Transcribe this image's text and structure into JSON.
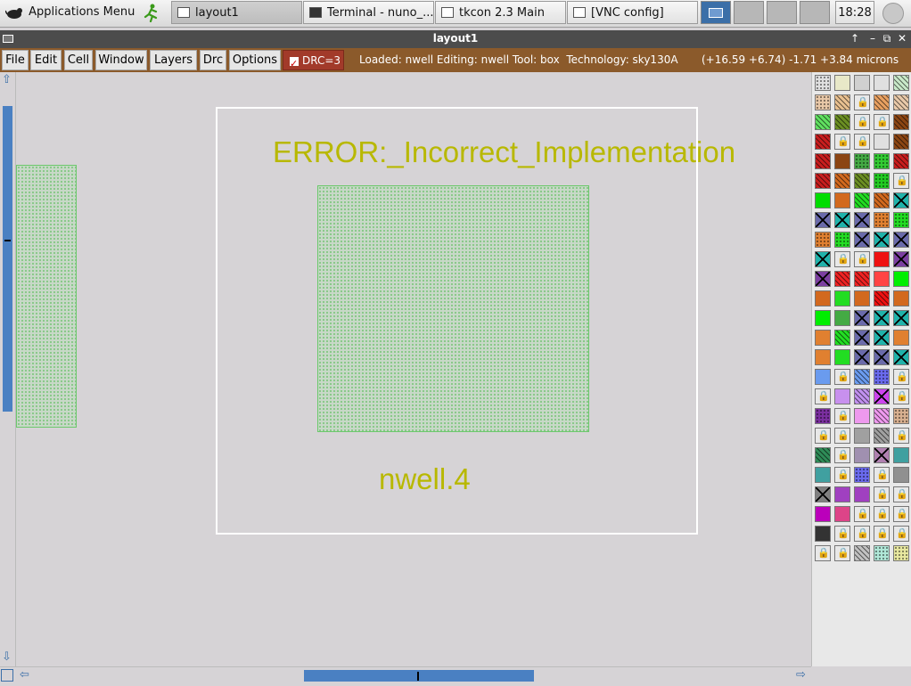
{
  "taskbar": {
    "apps_menu_label": "Applications Menu",
    "tasks": [
      {
        "label": "layout1",
        "active": true
      },
      {
        "label": "Terminal - nuno_...",
        "active": false
      },
      {
        "label": "tkcon 2.3 Main",
        "active": false
      },
      {
        "label": "[VNC config]",
        "active": false
      }
    ],
    "clock": "18:28"
  },
  "window": {
    "title": "layout1"
  },
  "menubar": {
    "items": [
      "File",
      "Edit",
      "Cell",
      "Window",
      "Layers",
      "Drc",
      "Options"
    ],
    "drc_label": "DRC=3",
    "status": "Loaded: nwell Editing: nwell Tool: box  Technology: sky130A",
    "coords": "(+16.59 +6.74) -1.71 +3.84 microns"
  },
  "canvas": {
    "error_label": "ERROR:_Incorrect_Implementation",
    "rule_label": "nwell.4",
    "colors": {
      "label_text": "#b8b800",
      "nwell_border": "#6cc86c",
      "selection_box": "#ffffff"
    }
  },
  "palette": {
    "rows": [
      [
        "#e0e0e0:dots",
        "#e8e8c8",
        "#d0d0d0",
        "#e0e0e0",
        "#c8e8c8:hatch"
      ],
      [
        "#e8c8a8:dots",
        "#e8c090:hatch",
        "#e8e8e8:lock",
        "#e8a060:hatch",
        "#e8c8a8:hatch"
      ],
      [
        "#60e060:hatch",
        "#6b8e23:hatch",
        "#e8e8e8:lock",
        "#e8e8e8:lock",
        "#8b4513:hatch"
      ],
      [
        "#c81e1e:hatch",
        "#e8e8e8:lock",
        "#e8e8e8:lock",
        "#e0e0e0",
        "#8b4513:hatch"
      ],
      [
        "#c81e1e:hatch",
        "#8b4513",
        "#44aa44:dots",
        "#33cc33:dots",
        "#c81e1e:hatch"
      ],
      [
        "#c81e1e:hatch",
        "#d2691e:hatch",
        "#6b8e23:hatch",
        "#22cc22:dots",
        "#e8e8e8:lock"
      ],
      [
        "#00dd00",
        "#d2691e",
        "#22dd22:hatch",
        "#d2691e:hatch",
        "#20b2aa:xx"
      ],
      [
        "#6a6aaa:xx",
        "#20b2aa:xx",
        "#6a6aaa:xx",
        "#e08030:dots",
        "#22dd22:dots"
      ],
      [
        "#e08030:dots",
        "#22dd22:dots",
        "#6a6aaa:xx",
        "#20b2aa:xx",
        "#6a6aaa:xx"
      ],
      [
        "#20b2aa:xx",
        "#e8e8e8:lock",
        "#e8e8e8:lock",
        "#ee1111",
        "#7b3fa0:xx"
      ],
      [
        "#7b3fa0:xx",
        "#ee2222:hatch",
        "#ee2222:hatch",
        "#ff4444",
        "#00ee00"
      ],
      [
        "#d2691e",
        "#22dd22",
        "#d2691e",
        "#ee1111:hatch",
        "#d2691e"
      ],
      [
        "#00ee00",
        "#44aa44",
        "#6a6aaa:xx",
        "#20b2aa:xx",
        "#20b2aa:xx"
      ],
      [
        "#e08030",
        "#22dd22:hatch",
        "#6a6aaa:xx",
        "#20b2aa:xx",
        "#e08030"
      ],
      [
        "#e08030",
        "#22dd22",
        "#6a6aaa:xx",
        "#6a6aaa:xx",
        "#20b2aa:xx"
      ],
      [
        "#6a9bee",
        "#e8e8e8:lock",
        "#6a9bee:hatch",
        "#6a6aee:dots",
        "#e8e8e8:lock"
      ],
      [
        "#e8e8e8:lock",
        "#c890ee",
        "#c090ee:hatch",
        "#cc44ee:xx",
        "#e8e8e8:lock"
      ],
      [
        "#7b2fa0:dots",
        "#e8e8e8:lock",
        "#ee99ee",
        "#ee99ee:hatch",
        "#d8b090:dots"
      ],
      [
        "#e8e8e8:lock",
        "#e8e8e8:lock",
        "#a0a0a0",
        "#a0a0a0:hatch",
        "#e8e8e8:lock"
      ],
      [
        "#2e8b57:hatch",
        "#e8e8e8:lock",
        "#a090b0",
        "#b080b0:xx",
        "#40a0a0"
      ],
      [
        "#40a0a0",
        "#e8e8e8:lock",
        "#6a6aee:dots",
        "#e8e8e8:lock",
        "#909090"
      ],
      [
        "#808080:xx",
        "#a040c0",
        "#a040c0",
        "#e8e8e8:lock",
        "#e8e8e8:lock"
      ],
      [
        "#bb00bb",
        "#dd4488",
        "#e8e8e8:lock",
        "#e8e8e8:lock",
        "#e8e8e8:lock"
      ],
      [
        "#333333",
        "#e8e8e8:lock",
        "#e8e8e8:lock",
        "#e8e8e8:lock",
        "#e8e8e8:lock"
      ],
      [
        "#e8e8e8:lock",
        "#e8e8e8:lock",
        "#c0c0c0:hatch",
        "#b0e8d8:dots",
        "#e8e8a0:dots"
      ]
    ]
  }
}
